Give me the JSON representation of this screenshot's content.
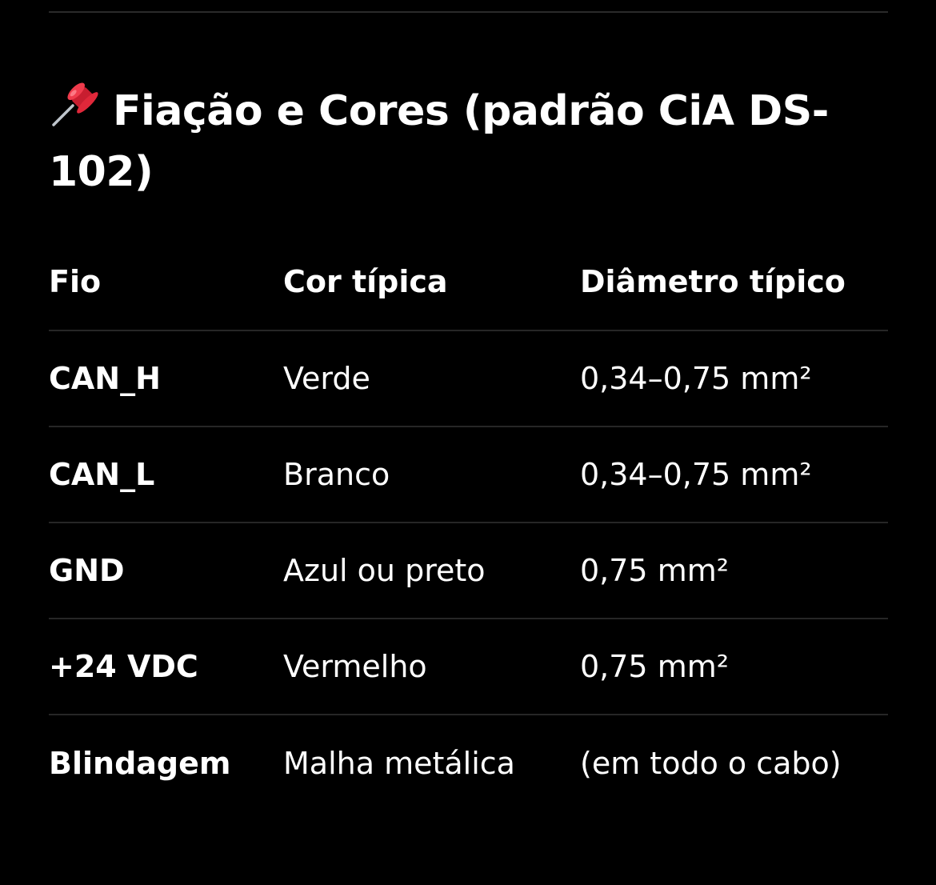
{
  "heading": {
    "icon": "pushpin-icon",
    "title": "Fiação e Cores (padrão CiA DS-102)"
  },
  "table": {
    "headers": [
      "Fio",
      "Cor típica",
      "Diâmetro típico"
    ],
    "rows": [
      [
        "CAN_H",
        "Verde",
        "0,34–0,75 mm²"
      ],
      [
        "CAN_L",
        "Branco",
        "0,34–0,75 mm²"
      ],
      [
        "GND",
        "Azul ou preto",
        "0,75 mm²"
      ],
      [
        "+24 VDC",
        "Vermelho",
        "0,75 mm²"
      ],
      [
        "Blindagem",
        "Malha metálica",
        "(em todo o cabo)"
      ]
    ]
  },
  "colors": {
    "background": "#000000",
    "text": "#ffffff",
    "divider": "#262626",
    "pin_red": "#e0283a"
  }
}
